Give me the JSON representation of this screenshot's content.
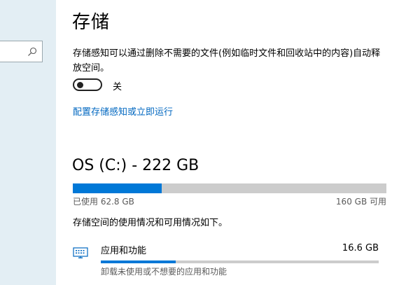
{
  "sidebar": {
    "search": {
      "placeholder": "",
      "icon": "search-icon"
    }
  },
  "page": {
    "title": "存储",
    "description": "存储感知可以通过删除不需要的文件(例如临时文件和回收站中的内容)自动释放空间。",
    "toggle": {
      "state": "off",
      "label": "关"
    },
    "config_link": "配置存储感知或立即运行"
  },
  "drive": {
    "title": "OS (C:) - 222 GB",
    "used_label": "已使用 62.8 GB",
    "free_label": "160 GB 可用",
    "used_fraction": 0.283
  },
  "summary": "存储空间的使用情况和可用情况如下。",
  "categories": [
    {
      "icon": "apps-features-icon",
      "name": "应用和功能",
      "size": "16.6 GB",
      "fraction": 0.27,
      "description": "卸载未使用或不想要的应用和功能"
    }
  ],
  "colors": {
    "accent": "#0078d7",
    "link": "#0067c0",
    "bar_bg": "#cccccc",
    "sidebar_bg": "#e3eef4"
  }
}
